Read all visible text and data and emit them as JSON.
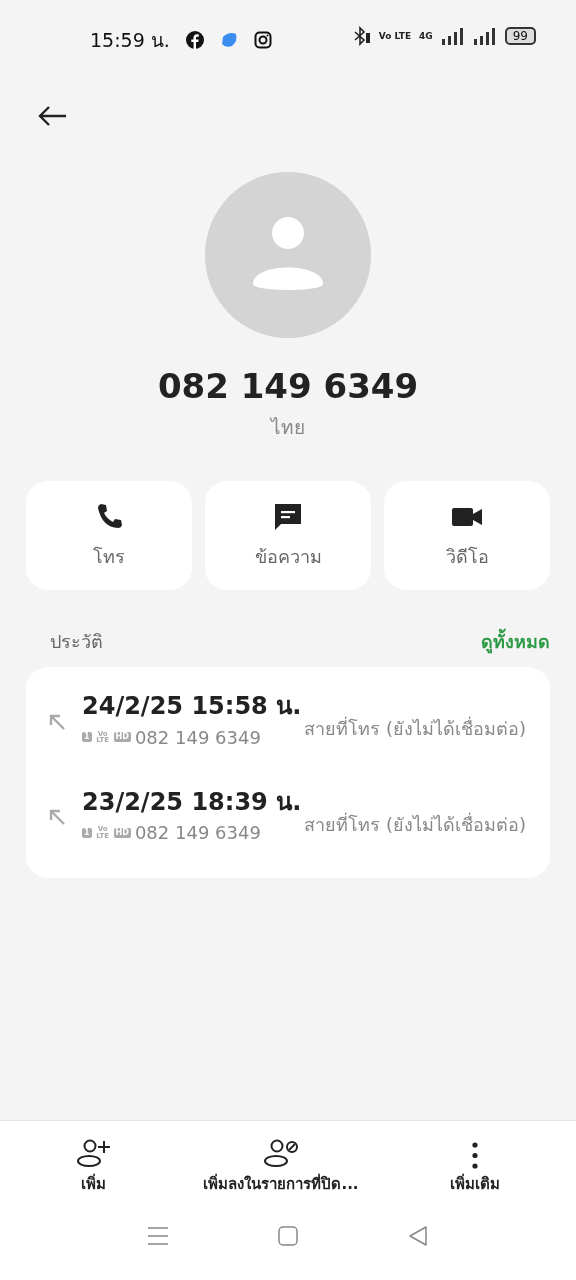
{
  "status_bar": {
    "time": "15:59 น.",
    "network_badges": [
      "Vo LTE",
      "4G"
    ],
    "battery": "99"
  },
  "contact": {
    "number": "082 149 6349",
    "location": "ไทย"
  },
  "actions": [
    {
      "kind": "call",
      "label": "โทร"
    },
    {
      "kind": "message",
      "label": "ข้อความ"
    },
    {
      "kind": "video",
      "label": "วิดีโอ"
    }
  ],
  "history": {
    "title": "ประวัติ",
    "link": "ดูทั้งหมด",
    "entries": [
      {
        "datetime": "24/2/25 15:58 น.",
        "badges": [
          "1",
          "Vo LTE",
          "HD"
        ],
        "number": "082 149 6349",
        "status": "สายที่โทร (ยังไม่ได้เชื่อมต่อ)"
      },
      {
        "datetime": "23/2/25 18:39 น.",
        "badges": [
          "1",
          "Vo LTE",
          "HD"
        ],
        "number": "082 149 6349",
        "status": "สายที่โทร (ยังไม่ได้เชื่อมต่อ)"
      }
    ]
  },
  "bottom_actions": [
    {
      "kind": "add",
      "label": "เพิ่ม"
    },
    {
      "kind": "block",
      "label": "เพิ่มลงในรายการที่ปิด..."
    },
    {
      "kind": "more",
      "label": "เพิ่มเติม"
    }
  ]
}
